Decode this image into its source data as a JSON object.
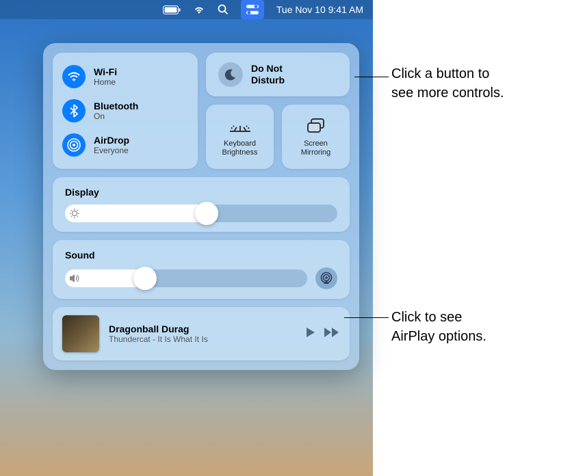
{
  "menubar": {
    "datetime": "Tue Nov 10  9:41 AM"
  },
  "connectivity": {
    "wifi": {
      "title": "Wi-Fi",
      "sub": "Home"
    },
    "bluetooth": {
      "title": "Bluetooth",
      "sub": "On"
    },
    "airdrop": {
      "title": "AirDrop",
      "sub": "Everyone"
    }
  },
  "dnd": {
    "label": "Do Not\nDisturb"
  },
  "keyboard_brightness": {
    "label": "Keyboard\nBrightness"
  },
  "screen_mirroring": {
    "label": "Screen\nMirroring"
  },
  "display": {
    "title": "Display",
    "value_pct": 52
  },
  "sound": {
    "title": "Sound",
    "value_pct": 33
  },
  "nowplaying": {
    "track": "Dragonball Durag",
    "artist_album": "Thundercat - It Is What It Is"
  },
  "callouts": {
    "top": "Click a button to\nsee more controls.",
    "bottom": "Click to see\nAirPlay options."
  }
}
